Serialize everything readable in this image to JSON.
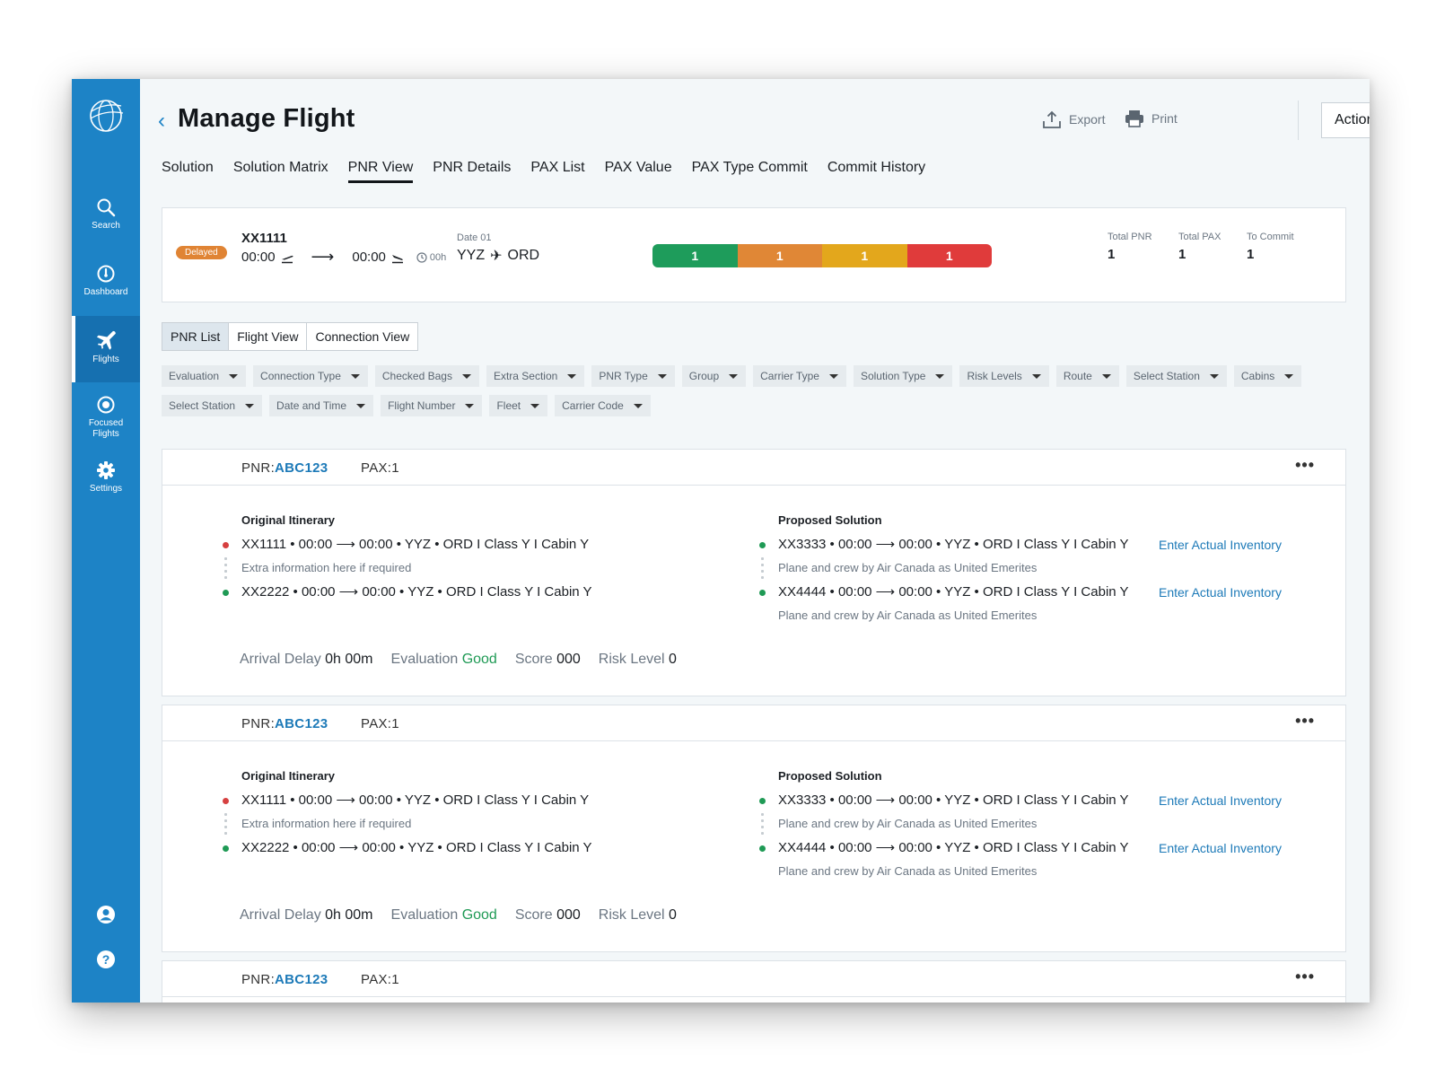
{
  "sidebar": {
    "items": [
      {
        "label": "Search",
        "icon": "search-icon"
      },
      {
        "label": "Dashboard",
        "icon": "dashboard-icon"
      },
      {
        "label": "Flights",
        "icon": "plane-icon"
      },
      {
        "label": "Focused Flights",
        "icon": "target-icon"
      },
      {
        "label": "Settings",
        "icon": "gear-icon"
      }
    ],
    "active": "Flights"
  },
  "header": {
    "title": "Manage Flight",
    "export_label": "Export",
    "print_label": "Print",
    "actions_label": "Actions"
  },
  "tabs": [
    "Solution",
    "Solution Matrix",
    "PNR View",
    "PNR Details",
    "PAX List",
    "PAX Value",
    "PAX Type Commit",
    "Commit History"
  ],
  "active_tab": "PNR View",
  "flight": {
    "status": "Delayed",
    "number": "XX1111",
    "dep_time": "00:00",
    "arr_time": "00:00",
    "duration": "00h",
    "date": "Date 01",
    "origin": "YYZ",
    "destination": "ORD",
    "risk_segments": [
      {
        "value": "1",
        "color": "#1e9c5b"
      },
      {
        "value": "1",
        "color": "#e08736"
      },
      {
        "value": "1",
        "color": "#e3a71c"
      },
      {
        "value": "1",
        "color": "#e03b3b"
      }
    ],
    "total_pnr_label": "Total PNR",
    "total_pnr": "1",
    "total_pax_label": "Total PAX",
    "total_pax": "1",
    "to_commit_label": "To Commit",
    "to_commit": "1"
  },
  "view_toggle": [
    "PNR List",
    "Flight View",
    "Connection View"
  ],
  "active_view": "PNR List",
  "filters_row1": [
    "Evaluation",
    "Connection Type",
    "Checked Bags",
    "Extra Section",
    "PNR Type",
    "Group",
    "Carrier Type",
    "Solution Type",
    "Risk Levels",
    "Route",
    "Select Station",
    "Cabins"
  ],
  "filters_row2": [
    "Select Station",
    "Date and Time",
    "Flight Number",
    "Fleet",
    "Carrier Code"
  ],
  "pnr": {
    "pnr_label": "PNR:",
    "code": "ABC123",
    "pax": "PAX:1",
    "more": "•••",
    "original_title": "Original Itinerary",
    "proposed_title": "Proposed Solution",
    "orig_leg1": "XX1111 • 00:00 ⟶ 00:00 • YYZ • ORD   I  Class Y  I  Cabin Y",
    "orig_info": "Extra information here if required",
    "orig_leg2": "XX2222 • 00:00 ⟶ 00:00 • YYZ • ORD   I  Class Y  I  Cabin Y",
    "prop_leg1": "XX3333 • 00:00 ⟶ 00:00 • YYZ • ORD   I  Class Y  I  Cabin Y",
    "prop_info": "Plane and crew by Air Canada as United Emerites",
    "prop_leg2": "XX4444 • 00:00 ⟶ 00:00 • YYZ • ORD   I  Class Y  I  Cabin Y",
    "link_label": "Enter Actual Inventory",
    "arrival_delay_label": "Arrival Delay",
    "arrival_delay": "0h 00m",
    "evaluation_label": "Evaluation",
    "evaluation": "Good",
    "score_label": "Score",
    "score": "000",
    "risk_label": "Risk Level",
    "risk": "0"
  },
  "colors": {
    "accent": "#1d83c6",
    "red_dot": "#d64040",
    "green_dot": "#1f9a55"
  }
}
